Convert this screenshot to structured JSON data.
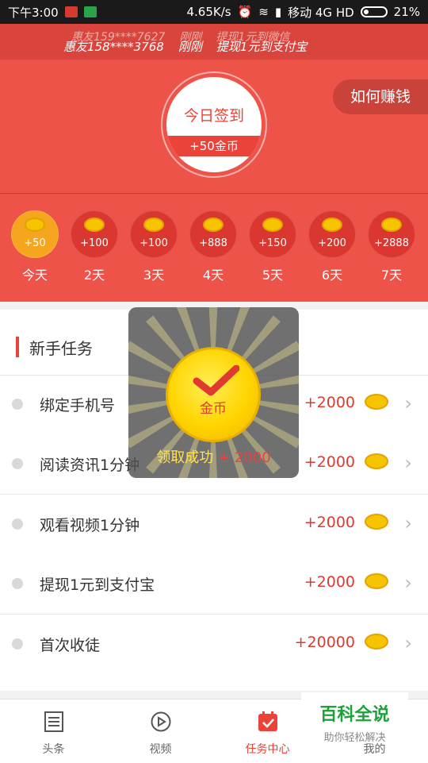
{
  "status_bar": {
    "time": "下午3:00",
    "speed": "4.65K/s",
    "carrier": "移动 4G HD",
    "battery": "21%"
  },
  "ticker": {
    "line1": [
      "惠友159****7627",
      "刚刚",
      "提现1元到微信"
    ],
    "line2": [
      "惠友158****3768",
      "刚刚",
      "提现1元到支付宝"
    ]
  },
  "signin": {
    "title": "今日签到",
    "reward": "+50金币"
  },
  "earn_button": "如何赚钱",
  "days": [
    {
      "amount": "+50",
      "label": "今天"
    },
    {
      "amount": "+100",
      "label": "2天"
    },
    {
      "amount": "+100",
      "label": "3天"
    },
    {
      "amount": "+888",
      "label": "4天"
    },
    {
      "amount": "+150",
      "label": "5天"
    },
    {
      "amount": "+200",
      "label": "6天"
    },
    {
      "amount": "+2888",
      "label": "7天"
    }
  ],
  "section_title": "新手任务",
  "tasks": [
    {
      "name": "绑定手机号",
      "points": "+2000"
    },
    {
      "name": "阅读资讯1分钟",
      "points": "+2000"
    },
    {
      "name": "观看视频1分钟",
      "points": "+2000"
    },
    {
      "name": "提现1元到支付宝",
      "points": "+2000"
    },
    {
      "name": "首次收徒",
      "points": "+20000"
    }
  ],
  "modal": {
    "coin_label": "金币",
    "message": "领取成功",
    "amount": "+ 2000"
  },
  "tabs": [
    {
      "label": "头条",
      "icon": "newspaper-icon"
    },
    {
      "label": "视频",
      "icon": "play-icon"
    },
    {
      "label": "任务中心",
      "icon": "calendar-check-icon"
    },
    {
      "label": "我的",
      "icon": "user-icon"
    }
  ],
  "watermark": {
    "title": "百科全说",
    "subtitle": "助你轻松解决"
  },
  "colors": {
    "primary_red": "#ee534a",
    "accent_red": "#e9433a",
    "gold": "#f6c400",
    "watermark_green": "#1ea13a"
  }
}
